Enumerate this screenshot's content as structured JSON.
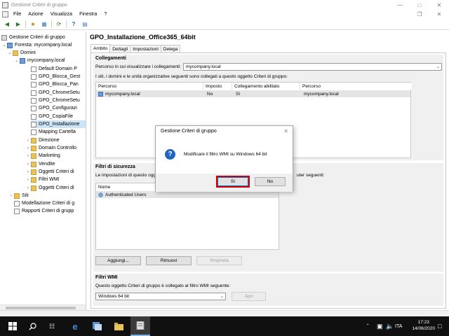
{
  "window": {
    "title": "Gestione Criteri di gruppo"
  },
  "menu": {
    "items": [
      "File",
      "Azione",
      "Visualizza",
      "Finestra",
      "?"
    ]
  },
  "tree": {
    "root": "Gestione Criteri di gruppo",
    "forest": "Foresta: mycompany.local",
    "domains": "Domini",
    "domain": "mycompany.local",
    "children": [
      "Default Domain P",
      "GPO_Blocca_Gest",
      "GPO_Blocca_Pan",
      "GPO_ChromeSetu",
      "GPO_ChromeSetu",
      "GPO_Configurazi",
      "GPO_CopiaFile",
      "GPO_Installazione",
      "Mapping Cartella",
      "Direzione",
      "Domain Controllo",
      "Marketing",
      "Vendite",
      "Oggetti Criteri di",
      "Filtri WMI",
      "Oggetti Criteri di"
    ],
    "sites": "Siti",
    "modeling": "Modellazione Criteri di g",
    "results": "Rapporti Criteri di grupp"
  },
  "gpo": {
    "title": "GPO_Installazione_Office365_64bit",
    "tabs": [
      "Ambito",
      "Dettagli",
      "Impostazioni",
      "Delega"
    ]
  },
  "links": {
    "header": "Collegamenti",
    "display_label": "Percorso in cui visualizzare i collegamenti:",
    "display_value": "mycompany.local",
    "desc": "I siti, i domini e le unità organizzative seguenti sono collegati a questo oggetto Criteri di gruppo:",
    "columns": [
      "Percorso",
      "Imposto",
      "Collegamento abilitato",
      "Percorso"
    ],
    "rows": [
      {
        "location": "mycompany.local",
        "enforced": "No",
        "enabled": "Sì",
        "path": "mycompany.local"
      }
    ]
  },
  "security": {
    "header": "Filtri di sicurezza",
    "desc_left": "Le impostazioni di questo ogge",
    "desc_right": "uter seguenti:",
    "column": "Nome",
    "rows": [
      "Authenticated Users"
    ],
    "buttons": {
      "add": "Aggiungi...",
      "remove": "Rimuovi",
      "properties": "Proprietà"
    }
  },
  "wmi": {
    "header": "Filtri WMI",
    "desc": "Questo oggetto Criteri di gruppo è collegato al filtro WMI seguente:",
    "value": "Windows 64 bit",
    "open": "Apri"
  },
  "dialog": {
    "title": "Gestione Criteri di gruppo",
    "message": "Modificare il filtro WMI su Windows 64 bit",
    "yes": "Sì",
    "no": "No"
  },
  "taskbar": {
    "time": "17:23",
    "date": "14/06/2020",
    "lang": "ITA"
  },
  "colors": {
    "accent": "#0078d7",
    "highlight": "#d40000",
    "selection": "#cce4f7"
  }
}
